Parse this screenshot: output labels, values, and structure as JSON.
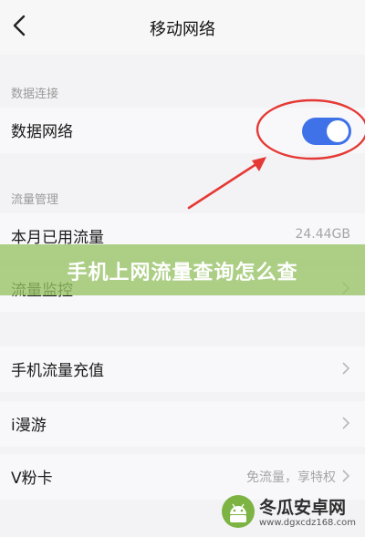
{
  "header": {
    "title": "移动网络",
    "back_icon": "chevron-left-icon"
  },
  "sections": {
    "data_connection": {
      "title": "数据连接",
      "mobile_data": {
        "label": "数据网络",
        "enabled": true
      }
    },
    "traffic_management": {
      "title": "流量管理",
      "used_this_month": {
        "label": "本月已用流量",
        "value": "24.44GB"
      },
      "traffic_monitor": {
        "label": "流量监控"
      },
      "recharge": {
        "label": "手机流量充值"
      },
      "roaming": {
        "label": "i漫游"
      },
      "v_card": {
        "label": "V粉卡",
        "value": "免流量，享特权"
      }
    }
  },
  "banner": {
    "text": "手机上网流量查询怎么查"
  },
  "watermark": {
    "brand": "冬瓜安卓网",
    "url": "www.dgxcdz168.com"
  },
  "colors": {
    "toggle_on": "#3f72e8",
    "annotation": "#e53935",
    "banner": "#96c364"
  }
}
